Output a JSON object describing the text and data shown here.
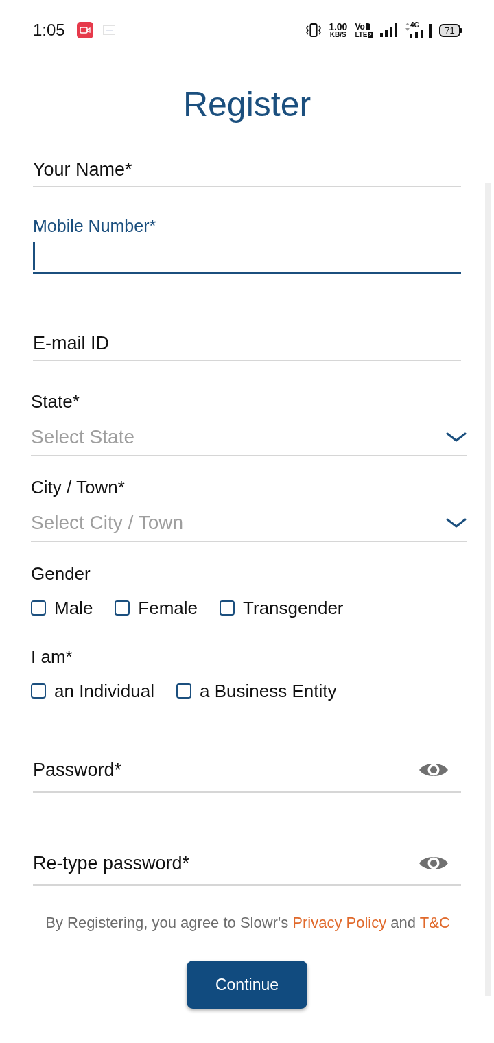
{
  "status_bar": {
    "time": "1:05",
    "speed_value": "1.00",
    "speed_unit": "KB/S",
    "volte_top": "Vo",
    "volte_bottom": "LTE",
    "sim_slot": "2",
    "network_type": "4G",
    "battery": "71"
  },
  "title": "Register",
  "fields": [
    {
      "kind": "text",
      "label": "Your Name*",
      "focused": false
    },
    {
      "kind": "text",
      "label": "Mobile Number*",
      "focused": true
    },
    {
      "kind": "text",
      "label": "E-mail ID",
      "focused": false
    },
    {
      "kind": "select",
      "label": "State*",
      "placeholder": "Select State"
    },
    {
      "kind": "select",
      "label": "City / Town*",
      "placeholder": "Select City / Town"
    },
    {
      "kind": "checkbox_group",
      "label": "Gender",
      "options": [
        {
          "label": "Male",
          "checked": false
        },
        {
          "label": "Female",
          "checked": false
        },
        {
          "label": "Transgender",
          "checked": false
        }
      ]
    },
    {
      "kind": "checkbox_group",
      "label": "I am*",
      "options": [
        {
          "label": "an Individual",
          "checked": false
        },
        {
          "label": "a Business Entity",
          "checked": false
        }
      ]
    },
    {
      "kind": "password",
      "label": "Password*",
      "focused": false
    },
    {
      "kind": "password",
      "label": "Re-type password*",
      "focused": false
    }
  ],
  "terms": [
    {
      "kind": "text",
      "text": "By Registering, you agree to Slowr's"
    },
    {
      "kind": "link",
      "text": "Privacy Policy"
    },
    {
      "kind": "text",
      "text": "and"
    },
    {
      "kind": "link",
      "text": "T&C"
    }
  ],
  "button": "Continue"
}
